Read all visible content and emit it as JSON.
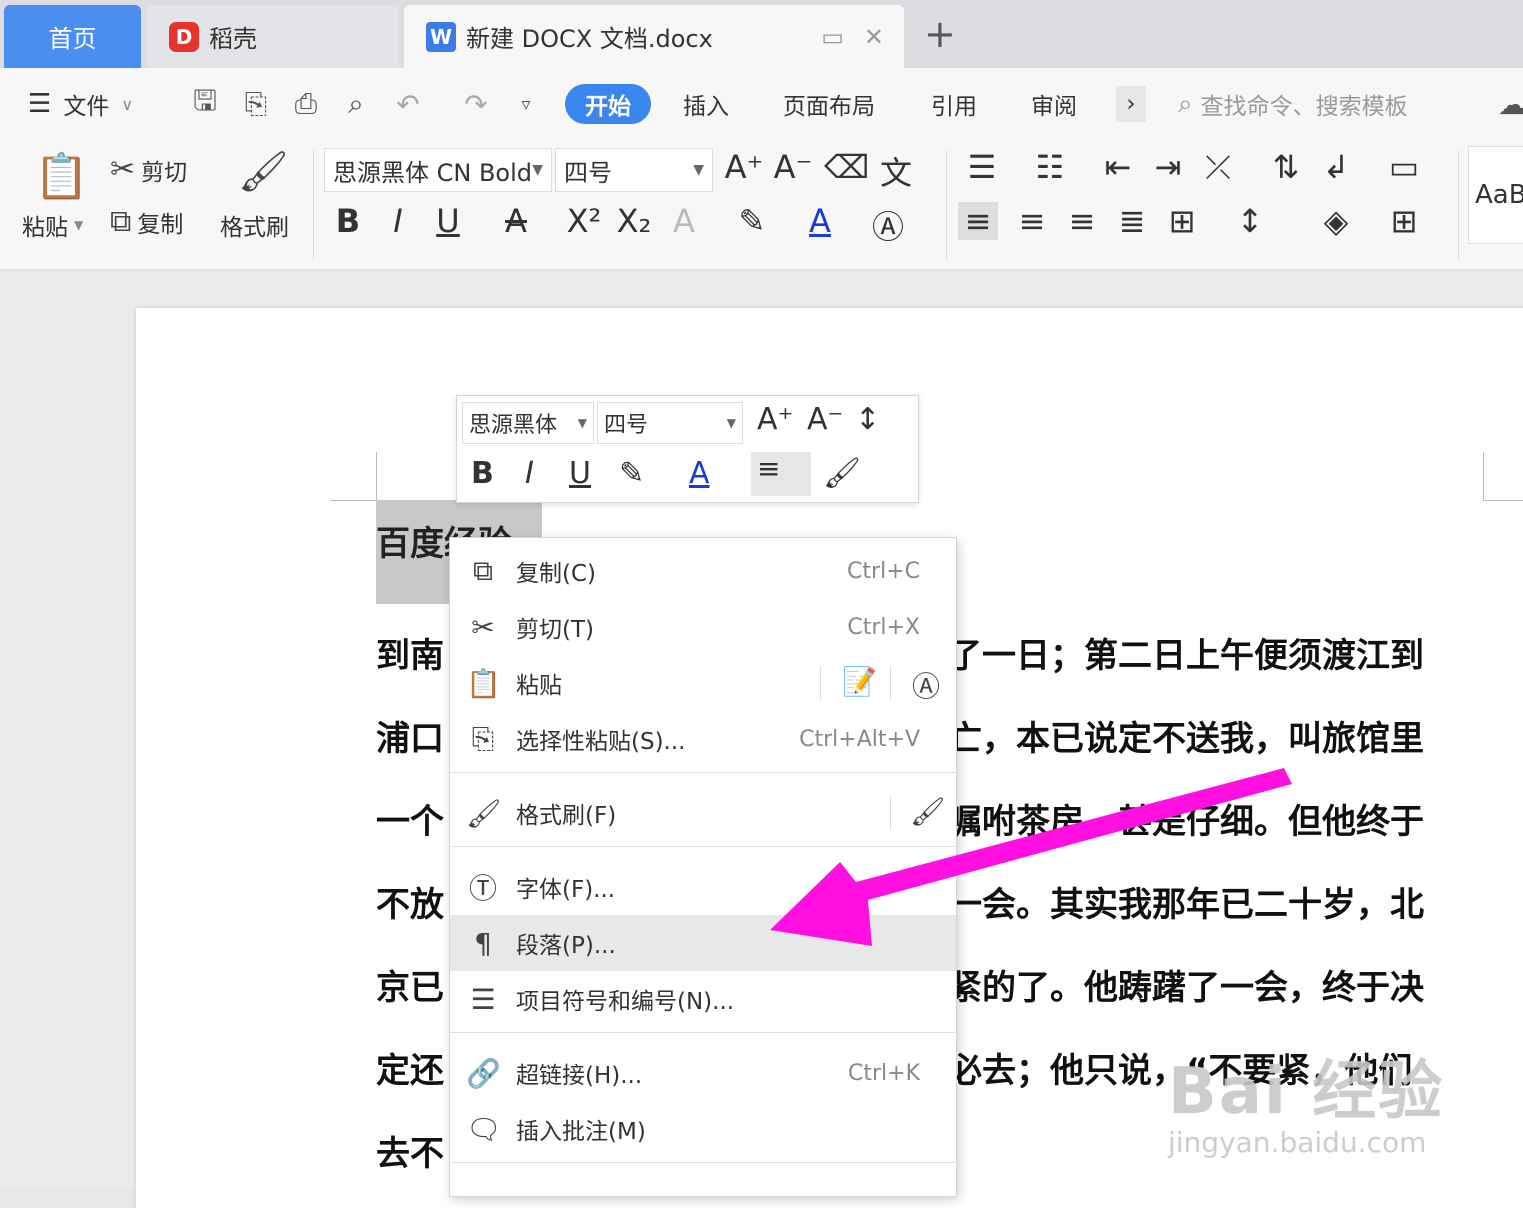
{
  "tabs": {
    "home": "首页",
    "daoke": "稻壳",
    "document": "新建 DOCX 文档.docx",
    "new_tab": "+"
  },
  "menubar": {
    "file": "文件",
    "items": [
      "开始",
      "插入",
      "页面布局",
      "引用",
      "审阅"
    ],
    "more": "›",
    "search_placeholder": "查找命令、搜索模板"
  },
  "ribbon": {
    "paste": "粘贴",
    "cut": "剪切",
    "copy": "复制",
    "format_painter": "格式刷",
    "font_name": "思源黑体 CN Bold",
    "font_size": "四号",
    "style_preview": "AaB"
  },
  "mini_toolbar": {
    "font_name": "思源黑体",
    "font_size": "四号"
  },
  "document": {
    "heading": "百度经验",
    "lines": [
      {
        "left": "到南",
        "right": "了一日；第二日上午便须渡江到"
      },
      {
        "left": "浦口",
        "right": "亡，本已说定不送我，叫旅馆里"
      },
      {
        "left": "一个",
        "right": "嘱咐茶房，甚是仔细。但他终于"
      },
      {
        "left": "不放",
        "right": "一会。其实我那年已二十岁，北"
      },
      {
        "left": "京已",
        "right": "紧的了。他踌躇了一会，终于决"
      },
      {
        "left": "定还",
        "right": "必去；他只说，“不要紧，他们"
      },
      {
        "left": "去不",
        "right": ""
      }
    ]
  },
  "context_menu": {
    "items": [
      {
        "label": "复制(C)",
        "shortcut": "Ctrl+C",
        "icon": "copy-icon"
      },
      {
        "label": "剪切(T)",
        "shortcut": "Ctrl+X",
        "icon": "scissors-icon"
      },
      {
        "label": "粘贴",
        "shortcut": "",
        "icon": "paste-icon"
      },
      {
        "label": "选择性粘贴(S)...",
        "shortcut": "Ctrl+Alt+V",
        "icon": "paste-special-icon"
      },
      {
        "label": "格式刷(F)",
        "shortcut": "",
        "icon": "brush-icon"
      },
      {
        "label": "字体(F)...",
        "shortcut": "",
        "icon": "font-icon"
      },
      {
        "label": "段落(P)...",
        "shortcut": "",
        "icon": "paragraph-icon"
      },
      {
        "label": "项目符号和编号(N)...",
        "shortcut": "",
        "icon": "list-icon"
      },
      {
        "label": "超链接(H)...",
        "shortcut": "Ctrl+K",
        "icon": "link-icon"
      },
      {
        "label": "插入批注(M)",
        "shortcut": "",
        "icon": "comment-icon"
      }
    ],
    "highlighted_index": 6
  },
  "annotation": {
    "arrow_color": "#ff10e0"
  },
  "watermark": {
    "brand": "Bai 经验",
    "url": "jingyan.baidu.com"
  },
  "colors": {
    "accent": "#3a86ee",
    "home_tab": "#4a8ef0",
    "daoke_logo": "#e8322d"
  }
}
